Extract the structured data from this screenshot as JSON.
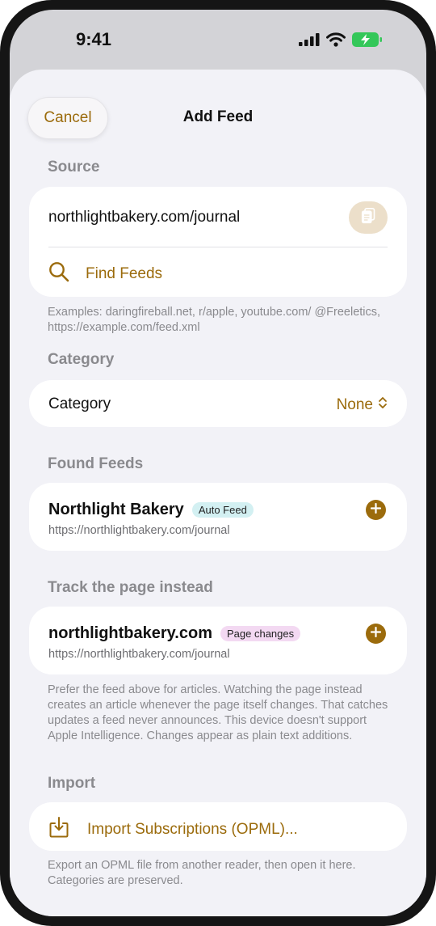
{
  "status_bar": {
    "time": "9:41"
  },
  "header": {
    "cancel_label": "Cancel",
    "title": "Add Feed"
  },
  "source": {
    "section_label": "Source",
    "url_value": "northlightbakery.com/journal",
    "find_feeds_label": "Find Feeds",
    "examples_text": "Examples: daringfireball.net, r/apple, youtube.com/ @Freeletics, https://example.com/feed.xml"
  },
  "category": {
    "section_label": "Category",
    "row_label": "Category",
    "selected_value": "None"
  },
  "found_feeds": {
    "section_label": "Found Feeds",
    "items": [
      {
        "title": "Northlight Bakery",
        "badge": "Auto Feed",
        "url": "https://northlightbakery.com/journal"
      }
    ]
  },
  "track_page": {
    "section_label": "Track the page instead",
    "items": [
      {
        "title": "northlightbakery.com",
        "badge": "Page changes",
        "url": "https://northlightbakery.com/journal"
      }
    ],
    "footer_text": "Prefer the feed above for articles. Watching the page instead creates an article whenever the page itself changes. That catches updates a feed never announces. This device doesn't support Apple Intelligence. Changes appear as plain text additions."
  },
  "import": {
    "section_label": "Import",
    "button_label": "Import Subscriptions (OPML)...",
    "footer_text": "Export an OPML file from another reader, then open it here. Categories are preserved."
  },
  "colors": {
    "accent": "#9b6b0c",
    "sheet_background": "#f2f2f7",
    "card_background": "#ffffff",
    "secondary_text": "#8a8a8e",
    "battery_green": "#34c759",
    "auto_feed_badge": "#d3f0f2",
    "page_changes_badge": "#f3d9f2"
  },
  "icons": {
    "signal": "cellular-signal-icon",
    "wifi": "wifi-icon",
    "battery": "battery-charging-icon",
    "paste": "clipboard-paste-icon",
    "search": "search-icon",
    "chevron": "chevron-up-down-icon",
    "add": "plus-circle-icon",
    "import": "tray-download-icon"
  }
}
